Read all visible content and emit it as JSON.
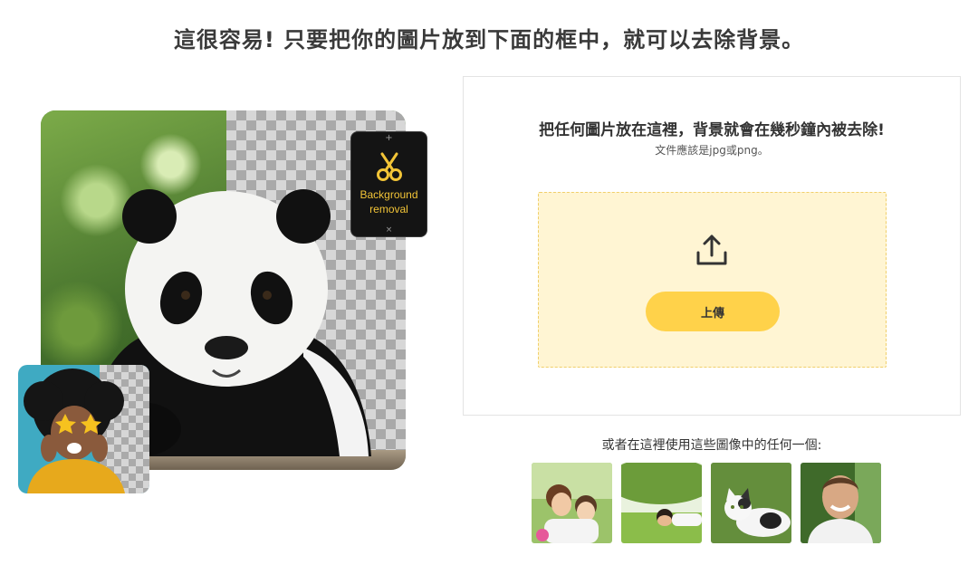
{
  "headline": "這很容易! 只要把你的圖片放到下面的框中，就可以去除背景。",
  "hero": {
    "badge_icon": "scissors-icon",
    "badge_label_line1": "Background",
    "badge_label_line2": "removal",
    "badge_pin_top": "+",
    "badge_pin_bottom": "×"
  },
  "upload": {
    "title": "把任何圖片放在這裡，背景就會在幾秒鐘內被去除!",
    "subtitle": "文件應該是jpg或png。",
    "icon": "upload-icon",
    "button_label": "上傳"
  },
  "samples": {
    "caption": "或者在這裡使用這些圖像中的任何一個:",
    "items": [
      {
        "subject": "mother-and-child"
      },
      {
        "subject": "person-lying-on-grass"
      },
      {
        "subject": "cat"
      },
      {
        "subject": "smiling-man"
      }
    ]
  },
  "colors": {
    "accent": "#ffd24a",
    "dropzone_bg": "#fff5d3",
    "badge_text": "#f2c437"
  }
}
